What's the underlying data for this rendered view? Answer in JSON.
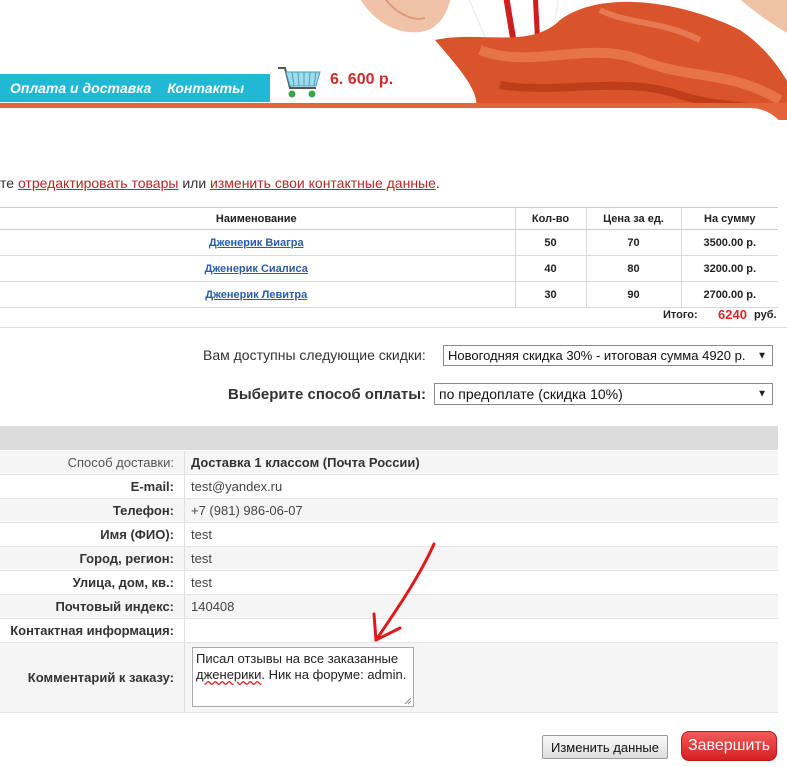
{
  "header": {
    "nav": [
      {
        "label": "Оплата и доставка"
      },
      {
        "label": "Контакты"
      }
    ],
    "cart_total": "6. 600 р."
  },
  "instructions": {
    "prefix": "те ",
    "link_edit_items": "отредактировать товары",
    "middle": " или ",
    "link_edit_contacts": "изменить свои контактные данные",
    "suffix": "."
  },
  "order_table": {
    "headers": {
      "name": "Наименование",
      "qty": "Кол-во",
      "price": "Цена за ед.",
      "sum": "На сумму"
    },
    "rows": [
      {
        "name": "Дженерик Виагра",
        "qty": "50",
        "price": "70",
        "sum": "3500.00 р."
      },
      {
        "name": "Дженерик Сиалиса",
        "qty": "40",
        "price": "80",
        "sum": "3200.00 р."
      },
      {
        "name": "Дженерик Левитра",
        "qty": "30",
        "price": "90",
        "sum": "2700.00 р."
      }
    ],
    "total_label": "Итого:",
    "total_value": "6240",
    "total_currency": "руб."
  },
  "discount": {
    "label": "Вам доступны следующие скидки:",
    "selected": "Новогодняя скидка 30% - итоговая сумма 4920 р."
  },
  "payment": {
    "label": "Выберите способ оплаты:",
    "selected": "по предоплате (скидка 10%)"
  },
  "details": [
    {
      "label": "Способ доставки:",
      "value": "Доставка 1 классом (Почта России)"
    },
    {
      "label": "E-mail:",
      "value": "test@yandex.ru"
    },
    {
      "label": "Телефон:",
      "value": "+7 (981) 986-06-07"
    },
    {
      "label": "Имя (ФИО):",
      "value": "test"
    },
    {
      "label": "Город, регион:",
      "value": "test"
    },
    {
      "label": "Улица, дом, кв.:",
      "value": "test"
    },
    {
      "label": "Почтовый индекс:",
      "value": "140408"
    },
    {
      "label": "Контактная информация:",
      "value": ""
    },
    {
      "label": "Комментарий к заказу:",
      "value": ""
    }
  ],
  "comment": {
    "part1": "Писал отзывы на все заказанные ",
    "part2": "дженерики",
    "part3": ". Ник на форуме: admin."
  },
  "buttons": {
    "edit": "Изменить данные",
    "finish": "Завершить"
  },
  "colors": {
    "nav_bg": "#21b8d5",
    "accent_red": "#d42a2a",
    "stripe_orange": "#e4643a",
    "link_blue": "#2a5ea6"
  }
}
